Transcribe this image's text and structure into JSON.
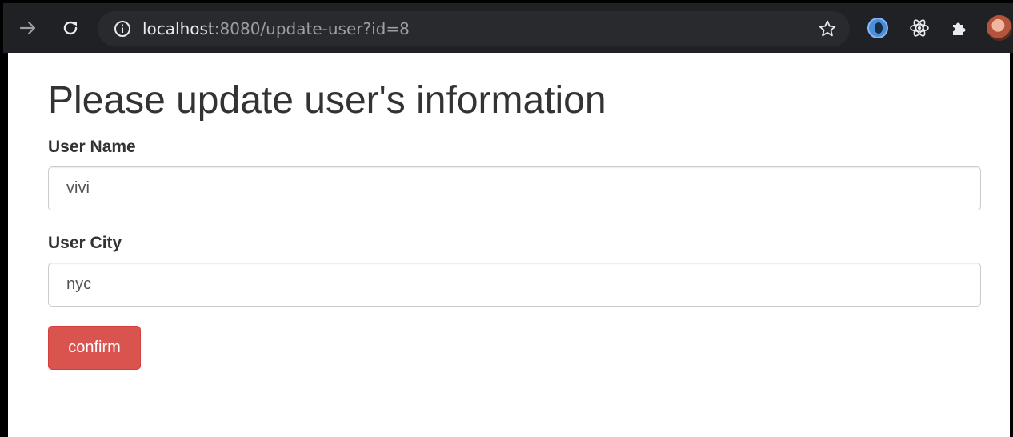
{
  "browser": {
    "url_host": "localhost",
    "url_rest": ":8080/update-user?id=8",
    "icons": [
      "forward-icon",
      "reload-icon",
      "info-icon",
      "star-icon",
      "extension-circle-icon",
      "react-icon",
      "puzzle-icon",
      "avatar"
    ]
  },
  "form": {
    "title": "Please update user's information",
    "name_label": "User Name",
    "name_value": "vivi",
    "city_label": "User City",
    "city_value": "nyc",
    "confirm_label": "confirm"
  },
  "colors": {
    "chrome_bg": "#202124",
    "omnibox_bg": "#282a2e",
    "confirm_bg": "#d9534f",
    "text": "#333333"
  }
}
